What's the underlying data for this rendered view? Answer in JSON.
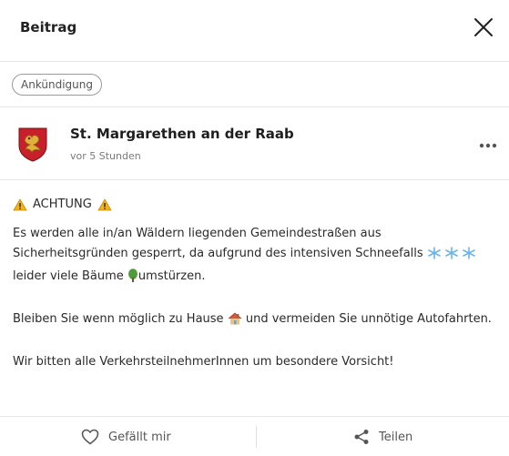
{
  "header": {
    "title": "Beitrag"
  },
  "tag": {
    "label": "Ankündigung"
  },
  "author": {
    "name": "St. Margarethen an der Raab",
    "time": "vor 5 Stunden"
  },
  "post": {
    "warning_text": "ACHTUNG",
    "p1_part1": "Es werden alle in/an Wäldern liegenden Gemeindestraßen aus Sicherheitsgründen gesperrt, da aufgrund des intensiven Schneefalls",
    "p1_part2": "leider viele Bäume",
    "p1_part3": "umstürzen.",
    "p2_part1": "Bleiben Sie wenn möglich zu Hause",
    "p2_part2": "und vermeiden Sie unnötige Autofahrten.",
    "p3": "Wir bitten alle VerkehrsteilnehmerInnen um besondere Vorsicht!"
  },
  "footer": {
    "like_label": "Gefällt mir",
    "share_label": "Teilen"
  },
  "icons": {
    "close": "close-icon",
    "more": "more-dots-icon",
    "warning": "warning-icon",
    "snowflake": "snowflake-icon",
    "tree": "tree-icon",
    "house": "house-icon",
    "heart": "heart-icon",
    "share": "share-icon"
  }
}
